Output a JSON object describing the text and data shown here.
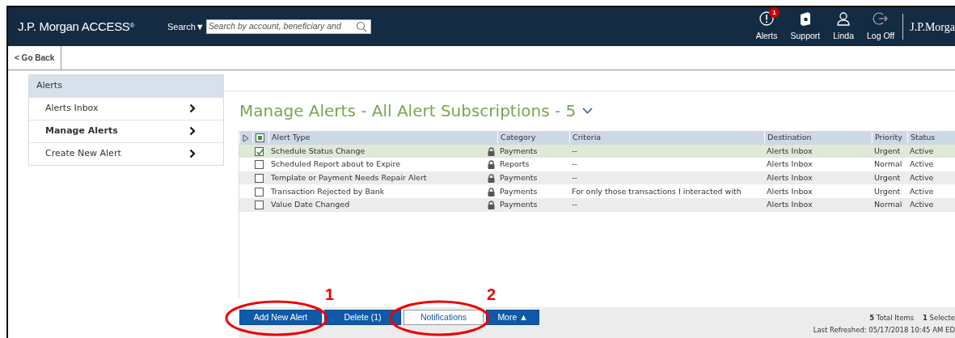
{
  "header": {
    "logo": "J.P. Morgan ACCESS$^{®}$",
    "search_label": "Search▼",
    "search": {
      "placeholder": "Search by account, beneficiary and"
    },
    "actions": [
      {
        "kind": "alerts",
        "label": "Alerts",
        "badge": "1"
      },
      {
        "kind": "support",
        "label": "Support"
      },
      {
        "kind": "user",
        "label": "Linda"
      },
      {
        "kind": "logoff",
        "label": "Log Off"
      }
    ],
    "brand": "J.P.Morga"
  },
  "back_button": "< Go Back",
  "sidebar": {
    "title": "Alerts",
    "items": [
      {
        "label": "Alerts Inbox",
        "selected": false
      },
      {
        "label": "Manage Alerts",
        "selected": true
      },
      {
        "label": "Create New Alert",
        "selected": false
      }
    ]
  },
  "page_title": "Manage Alerts - All Alert Subscriptions - 5",
  "table": {
    "select_all": {
      "indeterminate": true
    },
    "columns": [
      "Alert Type",
      "Category",
      "Criteria",
      "Destination",
      "Priority",
      "Status"
    ],
    "rows": [
      {
        "checked": true,
        "cells": [
          "Schedule Status Change",
          "Payments",
          "--",
          "Alerts Inbox",
          "Urgent",
          "Active"
        ]
      },
      {
        "checked": false,
        "cells": [
          "Scheduled Report about to Expire",
          "Reports",
          "--",
          "Alerts Inbox",
          "Normal",
          "Active"
        ]
      },
      {
        "checked": false,
        "cells": [
          "Template or Payment Needs Repair Alert",
          "Payments",
          "--",
          "Alerts Inbox",
          "Urgent",
          "Active"
        ]
      },
      {
        "checked": false,
        "cells": [
          "Transaction Rejected by Bank",
          "Payments",
          "For only those transactions I interacted with",
          "Alerts Inbox",
          "Urgent",
          "Active"
        ]
      },
      {
        "checked": false,
        "cells": [
          "Value Date Changed",
          "Payments",
          "--",
          "Alerts Inbox",
          "Normal",
          "Active"
        ]
      }
    ]
  },
  "footer": {
    "buttons": [
      {
        "label": "Add New Alert",
        "kind": "primary",
        "annotation": "1"
      },
      {
        "label": "Delete (1)",
        "kind": "primary"
      },
      {
        "label": "Notifications",
        "kind": "secondary",
        "annotation": "2"
      },
      {
        "label": "More ▲",
        "kind": "primary"
      }
    ],
    "total": "**5** Total Items",
    "selected_count": "**1** Selecte",
    "refreshed": "Last Refreshed: 05/17/2018 10:45 AM ED"
  }
}
